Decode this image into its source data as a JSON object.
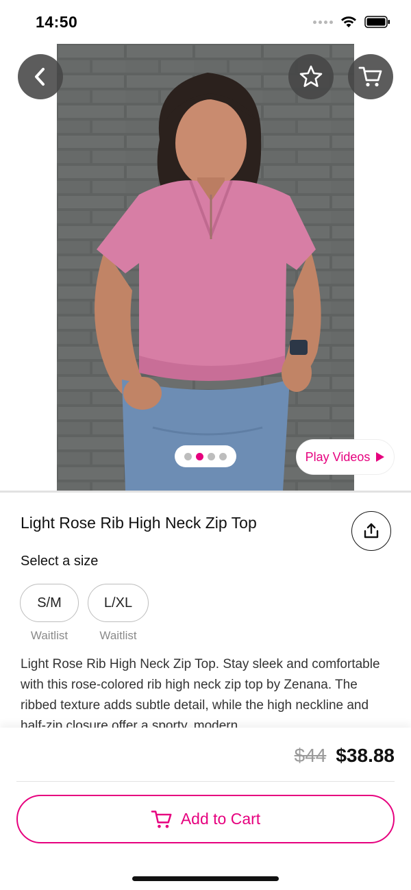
{
  "status_bar": {
    "time": "14:50",
    "icons": [
      "signal-dots",
      "wifi-icon",
      "battery-icon"
    ]
  },
  "hero": {
    "buttons": {
      "back": "chevron-left-icon",
      "favorite": "star-outline-icon",
      "cart": "cart-icon"
    },
    "pager": {
      "count": 4,
      "active_index": 1
    },
    "play_videos_label": "Play Videos"
  },
  "product": {
    "title": "Light Rose Rib High Neck Zip Top",
    "size_heading": "Select a size",
    "sizes": [
      {
        "label": "S/M",
        "note": "Waitlist"
      },
      {
        "label": "L/XL",
        "note": "Waitlist"
      }
    ],
    "description": "Light Rose Rib High Neck Zip Top. Stay sleek and comfortable with this rose-colored rib high neck zip top by Zenana. The ribbed texture adds subtle detail, while the high neckline and half-zip closure offer a sporty, modern"
  },
  "purchase": {
    "original_price": "$44",
    "sale_price": "$38.88",
    "add_to_cart_label": "Add to Cart"
  },
  "colors": {
    "accent": "#e6007e",
    "shirt": "#d77ea5",
    "wall": "#5f6261"
  }
}
